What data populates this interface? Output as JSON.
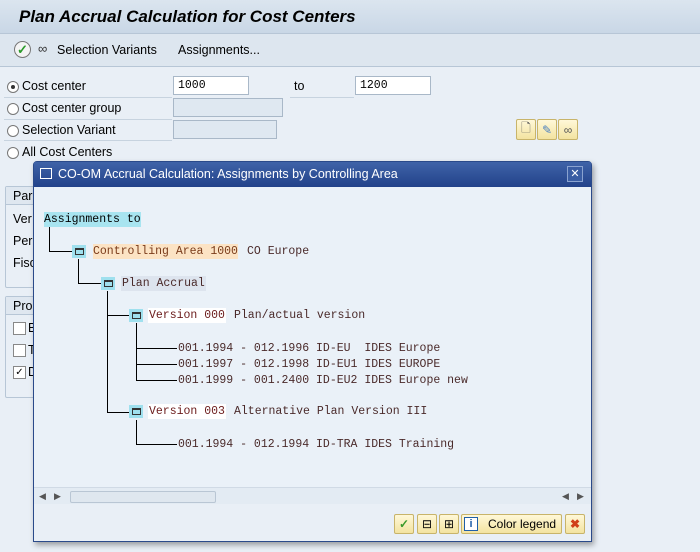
{
  "window": {
    "title": "Plan Accrual Calculation for Cost Centers"
  },
  "toolbar": {
    "execute_icon": "execute-clock-check-icon",
    "variants_icon": "glasses-icon",
    "selection_variants": "Selection Variants",
    "assignments": "Assignments..."
  },
  "selection": {
    "cost_center": {
      "label": "Cost center",
      "from": "1000",
      "to_label": "to",
      "to": "1200",
      "selected": true
    },
    "cost_center_group": {
      "label": "Cost center group",
      "value": ""
    },
    "selection_variant": {
      "label": "Selection Variant",
      "value": ""
    },
    "all_cost_centers": {
      "label": "All Cost Centers"
    }
  },
  "partial_groups": {
    "parameters": "Para",
    "param_rows": [
      "Ver",
      "Per",
      "Fisc"
    ],
    "processing": "Pro",
    "proc_rows": [
      {
        "label": "B",
        "checked": false
      },
      {
        "label": "T",
        "checked": false
      },
      {
        "label": "D",
        "checked": true
      }
    ]
  },
  "dialog": {
    "title": "CO-OM Accrual Calculation: Assignments by Controlling Area",
    "tree": {
      "root": "Assignments to",
      "controlling_area": {
        "key": "Controlling Area 1000",
        "text": "CO Europe"
      },
      "plan_accrual": "Plan Accrual",
      "versions": [
        {
          "key": "Version 000",
          "text": "Plan/actual version",
          "items": [
            "001.1994 - 012.1996 ID-EU  IDES Europe",
            "001.1997 - 012.1998 ID-EU1 IDES EUROPE",
            "001.1999 - 001.2400 ID-EU2 IDES Europe new"
          ]
        },
        {
          "key": "Version 003",
          "text": "Alternative Plan Version III",
          "items": [
            "001.1994 - 012.1994 ID-TRA IDES Training"
          ]
        }
      ]
    },
    "buttons": {
      "color_legend": "Color legend"
    },
    "colors": {
      "title_bar": "#2b4b90",
      "root_bg": "#a8e4f0",
      "ca_bg": "#fce3c4",
      "plan_bg": "#dde4ee"
    }
  }
}
